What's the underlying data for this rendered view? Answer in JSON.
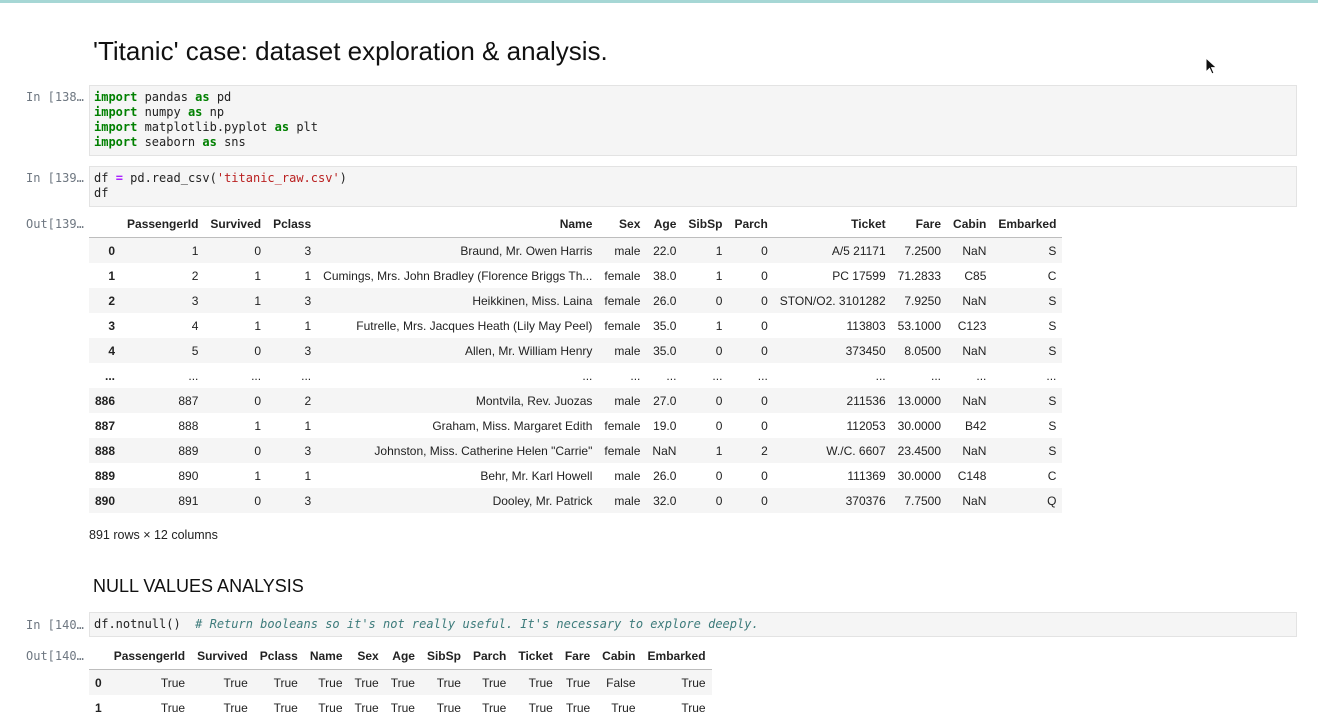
{
  "notebook": {
    "title": "'Titanic' case: dataset exploration & analysis.",
    "section_heading": "NULL VALUES ANALYSIS"
  },
  "cells": {
    "c138": {
      "prompt": "In [138…",
      "lines": [
        [
          {
            "t": "import",
            "c": "kw"
          },
          {
            "t": " pandas "
          },
          {
            "t": "as",
            "c": "kw"
          },
          {
            "t": " pd"
          }
        ],
        [
          {
            "t": "import",
            "c": "kw"
          },
          {
            "t": " numpy "
          },
          {
            "t": "as",
            "c": "kw"
          },
          {
            "t": " np"
          }
        ],
        [
          {
            "t": "import",
            "c": "kw"
          },
          {
            "t": " matplotlib.pyplot "
          },
          {
            "t": "as",
            "c": "kw"
          },
          {
            "t": " plt"
          }
        ],
        [
          {
            "t": "import",
            "c": "kw"
          },
          {
            "t": " seaborn "
          },
          {
            "t": "as",
            "c": "kw"
          },
          {
            "t": " sns"
          }
        ]
      ]
    },
    "c139": {
      "prompt": "In [139…",
      "out_prompt": "Out[139…",
      "lines": [
        [
          {
            "t": "df "
          },
          {
            "t": "=",
            "c": "op"
          },
          {
            "t": " pd.read_csv("
          },
          {
            "t": "'titanic_raw.csv'",
            "c": "str"
          },
          {
            "t": ")"
          }
        ],
        [
          {
            "t": "df"
          }
        ]
      ]
    },
    "c140": {
      "prompt": "In [140…",
      "out_prompt": "Out[140…",
      "lines": [
        [
          {
            "t": "df.notnull()  "
          },
          {
            "t": "# Return booleans so it's not really useful. It's necessary to explore deeply.",
            "c": "cmt"
          }
        ]
      ]
    }
  },
  "df_table": {
    "columns": [
      "",
      "PassengerId",
      "Survived",
      "Pclass",
      "Name",
      "Sex",
      "Age",
      "SibSp",
      "Parch",
      "Ticket",
      "Fare",
      "Cabin",
      "Embarked"
    ],
    "rows": [
      [
        "0",
        "1",
        "0",
        "3",
        "Braund, Mr. Owen Harris",
        "male",
        "22.0",
        "1",
        "0",
        "A/5 21171",
        "7.2500",
        "NaN",
        "S"
      ],
      [
        "1",
        "2",
        "1",
        "1",
        "Cumings, Mrs. John Bradley (Florence Briggs Th...",
        "female",
        "38.0",
        "1",
        "0",
        "PC 17599",
        "71.2833",
        "C85",
        "C"
      ],
      [
        "2",
        "3",
        "1",
        "3",
        "Heikkinen, Miss. Laina",
        "female",
        "26.0",
        "0",
        "0",
        "STON/O2. 3101282",
        "7.9250",
        "NaN",
        "S"
      ],
      [
        "3",
        "4",
        "1",
        "1",
        "Futrelle, Mrs. Jacques Heath (Lily May Peel)",
        "female",
        "35.0",
        "1",
        "0",
        "113803",
        "53.1000",
        "C123",
        "S"
      ],
      [
        "4",
        "5",
        "0",
        "3",
        "Allen, Mr. William Henry",
        "male",
        "35.0",
        "0",
        "0",
        "373450",
        "8.0500",
        "NaN",
        "S"
      ],
      [
        "...",
        "...",
        "...",
        "...",
        "...",
        "...",
        "...",
        "...",
        "...",
        "...",
        "...",
        "...",
        "..."
      ],
      [
        "886",
        "887",
        "0",
        "2",
        "Montvila, Rev. Juozas",
        "male",
        "27.0",
        "0",
        "0",
        "211536",
        "13.0000",
        "NaN",
        "S"
      ],
      [
        "887",
        "888",
        "1",
        "1",
        "Graham, Miss. Margaret Edith",
        "female",
        "19.0",
        "0",
        "0",
        "112053",
        "30.0000",
        "B42",
        "S"
      ],
      [
        "888",
        "889",
        "0",
        "3",
        "Johnston, Miss. Catherine Helen \"Carrie\"",
        "female",
        "NaN",
        "1",
        "2",
        "W./C. 6607",
        "23.4500",
        "NaN",
        "S"
      ],
      [
        "889",
        "890",
        "1",
        "1",
        "Behr, Mr. Karl Howell",
        "male",
        "26.0",
        "0",
        "0",
        "111369",
        "30.0000",
        "C148",
        "C"
      ],
      [
        "890",
        "891",
        "0",
        "3",
        "Dooley, Mr. Patrick",
        "male",
        "32.0",
        "0",
        "0",
        "370376",
        "7.7500",
        "NaN",
        "Q"
      ]
    ],
    "shape_note": "891 rows × 12 columns"
  },
  "notnull_table": {
    "columns": [
      "",
      "PassengerId",
      "Survived",
      "Pclass",
      "Name",
      "Sex",
      "Age",
      "SibSp",
      "Parch",
      "Ticket",
      "Fare",
      "Cabin",
      "Embarked"
    ],
    "rows": [
      [
        "0",
        "True",
        "True",
        "True",
        "True",
        "True",
        "True",
        "True",
        "True",
        "True",
        "True",
        "False",
        "True"
      ],
      [
        "1",
        "True",
        "True",
        "True",
        "True",
        "True",
        "True",
        "True",
        "True",
        "True",
        "True",
        "True",
        "True"
      ]
    ]
  },
  "icons": {
    "cursor": "mouse-pointer-icon"
  },
  "colors": {
    "top_bar": "#a6d7d5",
    "keyword": "#008000",
    "string": "#ba2121",
    "comment": "#3d7b7b",
    "prompt": "#6e7781"
  }
}
